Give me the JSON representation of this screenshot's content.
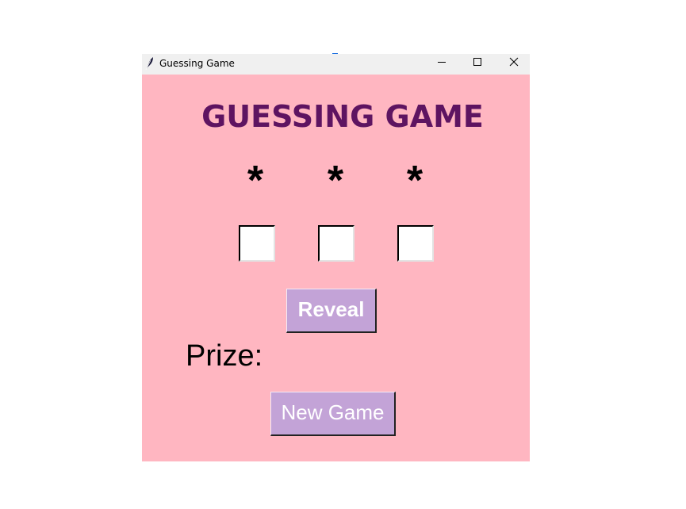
{
  "window": {
    "title": "Guessing Game",
    "icon": "feather-icon",
    "controls": [
      "minimize-icon",
      "maximize-icon",
      "close-icon"
    ]
  },
  "game": {
    "title": "GUESSING GAME",
    "stars": [
      "*",
      "*",
      "*"
    ],
    "guess_boxes": [
      {
        "checked": false
      },
      {
        "checked": false
      },
      {
        "checked": false
      }
    ],
    "reveal_label": "Reveal",
    "prize_label": "Prize:",
    "new_game_label": "New Game"
  },
  "colors": {
    "background": "#ffb6c1",
    "title": "#5e1461",
    "button": "#c3a3d7",
    "button_text": "#ffffff",
    "titlebar": "#f0f0f0"
  }
}
